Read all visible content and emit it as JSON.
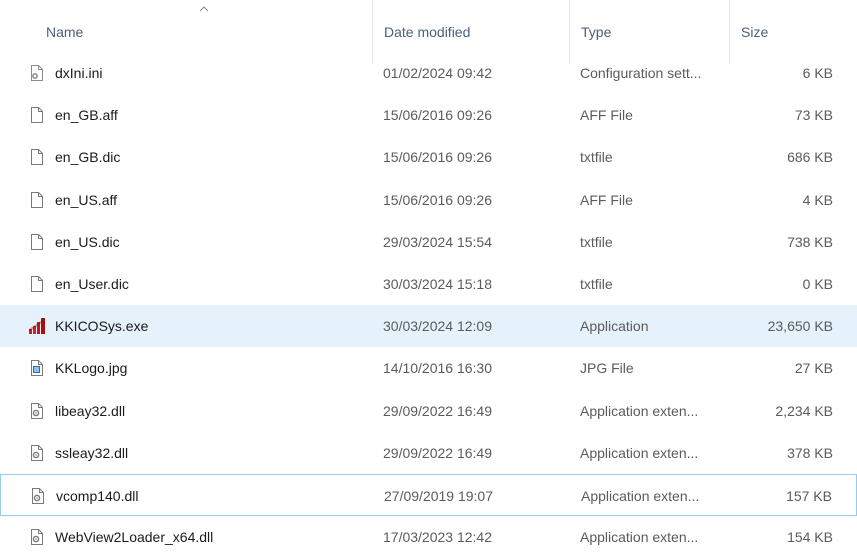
{
  "columns": {
    "name": "Name",
    "date": "Date modified",
    "type": "Type",
    "size": "Size",
    "sort_column": "name",
    "sort_direction": "ascending"
  },
  "colors": {
    "selected_row": "#e5f1fb",
    "focus_border": "#99c9ef",
    "header_text": "#4c607a"
  },
  "files": [
    {
      "name": "dxIni.ini",
      "date": "01/02/2024 09:42",
      "type": "Configuration sett...",
      "size": "6 KB",
      "icon": "settings-file-icon"
    },
    {
      "name": "en_GB.aff",
      "date": "15/06/2016 09:26",
      "type": "AFF File",
      "size": "73 KB",
      "icon": "blank-file-icon"
    },
    {
      "name": "en_GB.dic",
      "date": "15/06/2016 09:26",
      "type": "txtfile",
      "size": "686 KB",
      "icon": "blank-file-icon"
    },
    {
      "name": "en_US.aff",
      "date": "15/06/2016 09:26",
      "type": "AFF File",
      "size": "4 KB",
      "icon": "blank-file-icon"
    },
    {
      "name": "en_US.dic",
      "date": "29/03/2024 15:54",
      "type": "txtfile",
      "size": "738 KB",
      "icon": "blank-file-icon"
    },
    {
      "name": "en_User.dic",
      "date": "30/03/2024 15:18",
      "type": "txtfile",
      "size": "0 KB",
      "icon": "blank-file-icon"
    },
    {
      "name": "KKICOSys.exe",
      "date": "30/03/2024 12:09",
      "type": "Application",
      "size": "23,650 KB",
      "icon": "kkicosys-app-icon"
    },
    {
      "name": "KKLogo.jpg",
      "date": "14/10/2016 16:30",
      "type": "JPG File",
      "size": "27 KB",
      "icon": "image-file-icon"
    },
    {
      "name": "libeay32.dll",
      "date": "29/09/2022 16:49",
      "type": "Application exten...",
      "size": "2,234 KB",
      "icon": "dll-file-icon"
    },
    {
      "name": "ssleay32.dll",
      "date": "29/09/2022 16:49",
      "type": "Application exten...",
      "size": "378 KB",
      "icon": "dll-file-icon"
    },
    {
      "name": "vcomp140.dll",
      "date": "27/09/2019 19:07",
      "type": "Application exten...",
      "size": "157 KB",
      "icon": "dll-file-icon"
    },
    {
      "name": "WebView2Loader_x64.dll",
      "date": "17/03/2023 12:42",
      "type": "Application exten...",
      "size": "154 KB",
      "icon": "dll-file-icon"
    }
  ]
}
